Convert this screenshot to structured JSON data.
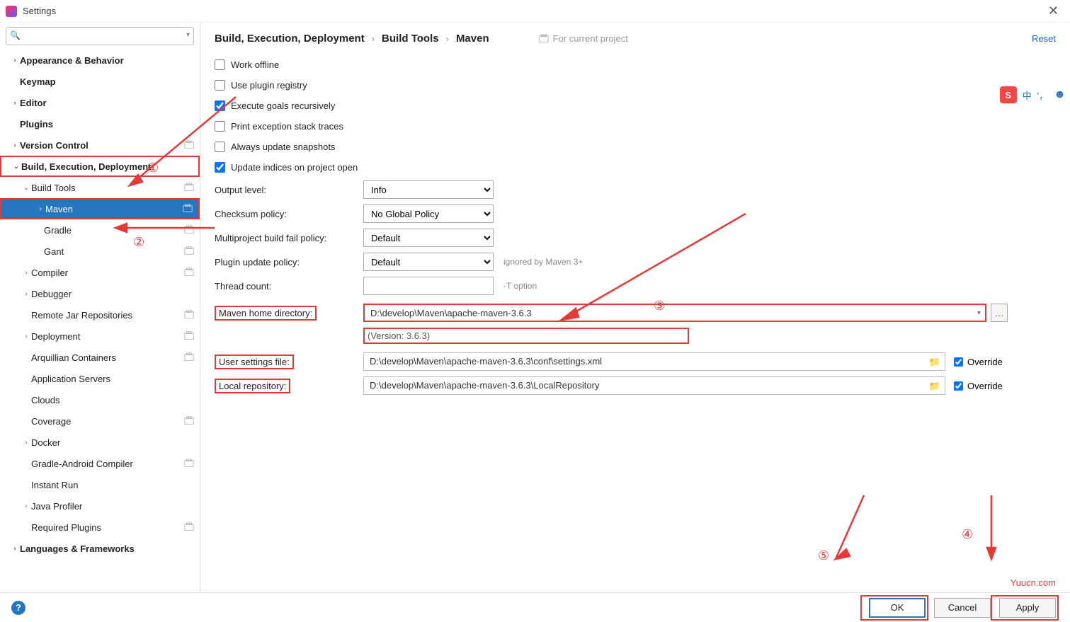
{
  "window": {
    "title": "Settings"
  },
  "search": {
    "placeholder": ""
  },
  "sidebar": {
    "items": [
      {
        "label": "Appearance & Behavior",
        "exp": "›",
        "bold": true,
        "ind": 0
      },
      {
        "label": "Keymap",
        "exp": "",
        "bold": true,
        "ind": 0
      },
      {
        "label": "Editor",
        "exp": "›",
        "bold": true,
        "ind": 0
      },
      {
        "label": "Plugins",
        "exp": "",
        "bold": true,
        "ind": 0
      },
      {
        "label": "Version Control",
        "exp": "›",
        "bold": true,
        "ind": 0,
        "proj": true
      },
      {
        "label": "Build, Execution, Deployment",
        "exp": "⌄",
        "bold": true,
        "ind": 0,
        "red": true
      },
      {
        "label": "Build Tools",
        "exp": "⌄",
        "bold": false,
        "ind": 1,
        "proj": true
      },
      {
        "label": "Maven",
        "exp": "›",
        "bold": false,
        "ind": 2,
        "proj": true,
        "selected": true,
        "red": true
      },
      {
        "label": "Gradle",
        "exp": "",
        "bold": false,
        "ind": 2,
        "proj": true
      },
      {
        "label": "Gant",
        "exp": "",
        "bold": false,
        "ind": 2,
        "proj": true
      },
      {
        "label": "Compiler",
        "exp": "›",
        "bold": false,
        "ind": 1,
        "proj": true
      },
      {
        "label": "Debugger",
        "exp": "›",
        "bold": false,
        "ind": 1
      },
      {
        "label": "Remote Jar Repositories",
        "exp": "",
        "bold": false,
        "ind": 1,
        "proj": true
      },
      {
        "label": "Deployment",
        "exp": "›",
        "bold": false,
        "ind": 1,
        "proj": true
      },
      {
        "label": "Arquillian Containers",
        "exp": "",
        "bold": false,
        "ind": 1,
        "proj": true
      },
      {
        "label": "Application Servers",
        "exp": "",
        "bold": false,
        "ind": 1
      },
      {
        "label": "Clouds",
        "exp": "",
        "bold": false,
        "ind": 1
      },
      {
        "label": "Coverage",
        "exp": "",
        "bold": false,
        "ind": 1,
        "proj": true
      },
      {
        "label": "Docker",
        "exp": "›",
        "bold": false,
        "ind": 1
      },
      {
        "label": "Gradle-Android Compiler",
        "exp": "",
        "bold": false,
        "ind": 1,
        "proj": true
      },
      {
        "label": "Instant Run",
        "exp": "",
        "bold": false,
        "ind": 1
      },
      {
        "label": "Java Profiler",
        "exp": "›",
        "bold": false,
        "ind": 1
      },
      {
        "label": "Required Plugins",
        "exp": "",
        "bold": false,
        "ind": 1,
        "proj": true
      },
      {
        "label": "Languages & Frameworks",
        "exp": "›",
        "bold": true,
        "ind": 0
      }
    ]
  },
  "breadcrumb": {
    "a": "Build, Execution, Deployment",
    "b": "Build Tools",
    "c": "Maven",
    "proj": "For current project",
    "reset": "Reset"
  },
  "checks": {
    "work_offline": "Work offline",
    "plugin_registry": "Use plugin registry",
    "exec_goals": "Execute goals recursively",
    "print_exc": "Print exception stack traces",
    "update_snap": "Always update snapshots",
    "update_idx": "Update indices on project open"
  },
  "fields": {
    "output_level": {
      "label": "Output level:",
      "value": "Info"
    },
    "checksum": {
      "label": "Checksum policy:",
      "value": "No Global Policy"
    },
    "multiproj": {
      "label": "Multiproject build fail policy:",
      "value": "Default"
    },
    "plugin_upd": {
      "label": "Plugin update policy:",
      "value": "Default",
      "hint": "ignored by Maven 3+"
    },
    "thread": {
      "label": "Thread count:",
      "value": "",
      "hint": "-T option"
    },
    "home": {
      "label": "Maven home directory:",
      "value": "D:\\develop\\Maven\\apache-maven-3.6.3",
      "version": "(Version: 3.6.3)"
    },
    "user_settings": {
      "label": "User settings file:",
      "value": "D:\\develop\\Maven\\apache-maven-3.6.3\\conf\\settings.xml",
      "override": "Override"
    },
    "local_repo": {
      "label": "Local repository:",
      "value": "D:\\develop\\Maven\\apache-maven-3.6.3\\LocalRepository",
      "override": "Override"
    }
  },
  "buttons": {
    "ok": "OK",
    "cancel": "Cancel",
    "apply": "Apply"
  },
  "annot": {
    "n1": "①",
    "n2": "②",
    "n3": "③",
    "n4": "④",
    "n5": "⑤"
  },
  "ime": {
    "zh": "中",
    "pt": "'，"
  },
  "watermark": "Yuucn.com"
}
